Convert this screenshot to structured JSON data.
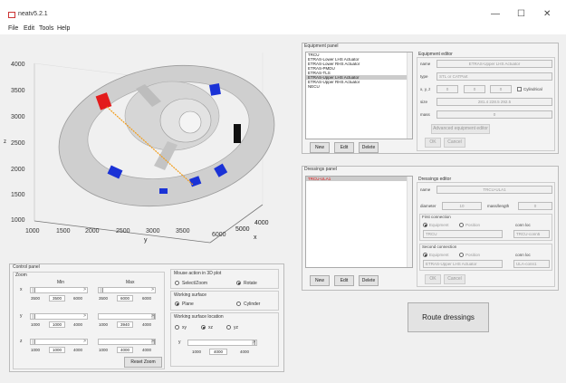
{
  "window": {
    "title": "neatv5.2.1",
    "minimize": "—",
    "maximize": "☐",
    "close": "✕"
  },
  "menu": [
    "File",
    "Edit",
    "Tools",
    "Help"
  ],
  "plot": {
    "y_ticks": [
      "4000",
      "3500",
      "3000",
      "2500",
      "2000",
      "1500",
      "1000"
    ],
    "y_tick_prefix_2500": "z",
    "x_ticks": [
      "1000",
      "1500",
      "2000",
      "2500",
      "3000",
      "3500",
      "6000"
    ],
    "x_label": "y",
    "z_ticks": [
      "4000",
      "5000",
      "6000"
    ],
    "z_label": "x",
    "colors": {
      "ring": "#cfcfcf",
      "ring_edge": "#9a9a9a",
      "red_box": "#e31b1b",
      "blue_box": "#1a32d6",
      "black_box": "#111111",
      "route_line": "#f29d1a"
    }
  },
  "control_panel": {
    "title": "Control panel",
    "zoom": {
      "title": "Zoom",
      "min_label": "Min",
      "max_label": "Max",
      "rows": [
        {
          "axis": "x",
          "min": {
            "lo": "3500",
            "val": "3500",
            "hi": "6000"
          },
          "max": {
            "lo": "3500",
            "val": "6000",
            "hi": "6000"
          }
        },
        {
          "axis": "y",
          "min": {
            "lo": "1000",
            "val": "1000",
            "hi": "4000"
          },
          "max": {
            "lo": "1000",
            "val": "3940",
            "hi": "4000"
          }
        },
        {
          "axis": "z",
          "min": {
            "lo": "1000",
            "val": "1000",
            "hi": "4000"
          },
          "max": {
            "lo": "1000",
            "val": "4000",
            "hi": "4000"
          }
        }
      ],
      "reset_label": "Reset Zoom"
    },
    "mouse_action": {
      "title": "Mouse action in 3D plot",
      "options": [
        "Select/Zoom",
        "Rotate"
      ],
      "selected": "Rotate"
    },
    "working_surface": {
      "title": "Working surface",
      "options": [
        "Plane",
        "Cylinder"
      ],
      "selected": "Plane"
    },
    "working_surface_location": {
      "title": "Working surface location",
      "options": [
        "xy",
        "xz",
        "yz"
      ],
      "selected": "xz",
      "axis": "y",
      "lo": "1000",
      "val": "4000",
      "hi": "4000"
    }
  },
  "equipment_panel": {
    "title": "Equipment panel",
    "items": [
      "TRCU",
      "ETRAS-Lower LHS Actuator",
      "ETRAS-Lower RHS Actuator",
      "ETRAS-PMDU",
      "ETRAS-TLS",
      "ETRAS-Upper LHS Actuator",
      "ETRAS-Upper RHS Actuator",
      "NECU"
    ],
    "selected_index": 5,
    "buttons": {
      "new": "New",
      "edit": "Edit",
      "delete": "Delete"
    },
    "editor": {
      "title": "Equipment editor",
      "name_label": "name",
      "name_value": "ETRAS-Upper LHS Actuator",
      "type_label": "type",
      "type_value": "STL or CATPart",
      "xyz_label": "x, y, z",
      "x": "0",
      "y": "0",
      "z": "0",
      "cylindrical_label": "Cylindrical",
      "size_label": "size",
      "size_value": "281.4 228.5 292.5",
      "mass_label": "mass",
      "mass_value": "0",
      "advanced_label": "Advanced equipment editor",
      "ok_label": "OK",
      "cancel_label": "Cancel"
    }
  },
  "dressings_panel": {
    "title": "Dressings panel",
    "items": [
      "TRCU-ULA1"
    ],
    "selected_index": 0,
    "buttons": {
      "new": "New",
      "edit": "Edit",
      "delete": "Delete"
    },
    "editor": {
      "title": "Dressings editor",
      "name_label": "name",
      "name_value": "TRCU-ULA1",
      "diameter_label": "diameter",
      "diameter_value": "10",
      "mass_length_label": "mass/length",
      "mass_length_value": "0",
      "first": {
        "title": "First connection",
        "opt_equipment": "Equipment",
        "opt_position": "Position",
        "conn_loc_label": "conn loc",
        "equipment_value": "TRCU",
        "conn_loc_value": "TRCU-conn5"
      },
      "second": {
        "title": "Second connection",
        "opt_equipment": "Equipment",
        "opt_position": "Position",
        "conn_loc_label": "conn loc",
        "equipment_value": "ETRAS-Upper LHS Actuator",
        "conn_loc_value": "ULA-conn1"
      },
      "ok_label": "OK",
      "cancel_label": "Cancel"
    }
  },
  "route_button": "Route dressings"
}
